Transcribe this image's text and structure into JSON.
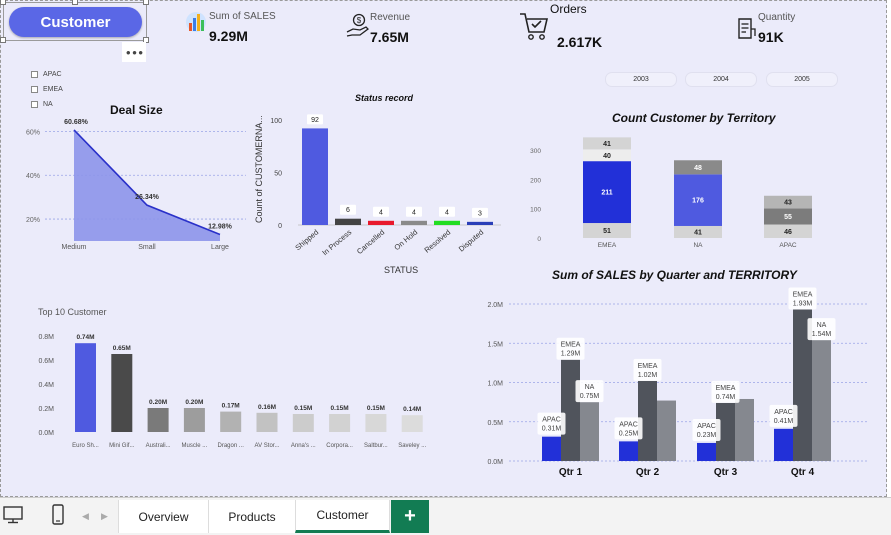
{
  "page_button": {
    "label": "Customer"
  },
  "kpis": [
    {
      "label": "Sum of SALES",
      "value": "9.29M",
      "icon": "bar-chart-icon"
    },
    {
      "label": "Revenue",
      "value": "7.65M",
      "icon": "hand-dollar-icon"
    },
    {
      "label": "Orders",
      "value": "2.617K",
      "icon": "shopping-cart-icon"
    },
    {
      "label": "Quantity",
      "value": "91K",
      "icon": "receipt-icon"
    }
  ],
  "territory_slicer": {
    "items": [
      "APAC",
      "EMEA",
      "NA"
    ]
  },
  "year_slicer": {
    "items": [
      "2003",
      "2004",
      "2005"
    ]
  },
  "colors": {
    "accent": "#5a67e6",
    "tab_green": "#127c53",
    "canvas": "#ebebfa"
  },
  "charts": [
    {
      "type": "area",
      "title": "Deal Size",
      "categories": [
        "Medium",
        "Small",
        "Large"
      ],
      "values": [
        60.68,
        26.34,
        12.98
      ],
      "data_labels": [
        "60.68%",
        "26.34%",
        "12.98%"
      ],
      "y_ticks": [
        "60%",
        "40%",
        "20%"
      ],
      "ylim": [
        10,
        62
      ]
    },
    {
      "type": "bar",
      "title": "Status record",
      "xlabel": "STATUS",
      "ylabel": "Count of CUSTOMERNA...",
      "categories": [
        "Shipped",
        "In Process",
        "Cancelled",
        "On Hold",
        "Resolved",
        "Disputed"
      ],
      "values": [
        92,
        6,
        4,
        4,
        4,
        3
      ],
      "bar_colors": [
        "#4f5ae0",
        "#444444",
        "#e8192c",
        "#8a8a8a",
        "#22dd22",
        "#2a3fb8"
      ],
      "y_ticks": [
        "100",
        "50",
        "0"
      ],
      "ylim": [
        0,
        100
      ]
    },
    {
      "type": "bar",
      "title": "Count Customer by Territory",
      "categories": [
        "EMEA",
        "NA",
        "APAC"
      ],
      "series": [
        {
          "values": [
            51,
            41,
            46
          ],
          "colors": [
            "#d4d4d4",
            "#d4d4d4",
            "#d4d4d4"
          ]
        },
        {
          "values": [
            211,
            176,
            55
          ],
          "colors": [
            "#2230d8",
            "#4f5ae0",
            "#7c7c7c"
          ]
        },
        {
          "values": [
            40,
            48,
            43
          ],
          "colors": [
            "#ededed",
            "#8a8a8a",
            "#b5b5b5"
          ]
        },
        {
          "values": [
            41,
            0,
            0
          ],
          "colors": [
            "#d4d4d4",
            "#d4d4d4",
            "#d4d4d4"
          ]
        }
      ],
      "y_ticks": [
        "300",
        "200",
        "100",
        "0"
      ],
      "ylim": [
        0,
        300
      ]
    },
    {
      "type": "bar",
      "title": "Top 10 Customer",
      "categories": [
        "Euro Sh...",
        "Mini Gif...",
        "Australi...",
        "Muscle ...",
        "Dragon ...",
        "AV Stor...",
        "Anna's ...",
        "Corpora...",
        "Saltbur...",
        "Saveley ..."
      ],
      "values": [
        0.74,
        0.65,
        0.2,
        0.2,
        0.17,
        0.16,
        0.15,
        0.15,
        0.15,
        0.14
      ],
      "data_labels": [
        "0.74M",
        "0.65M",
        "0.20M",
        "0.20M",
        "0.17M",
        "0.16M",
        "0.15M",
        "0.15M",
        "0.15M",
        "0.14M"
      ],
      "bar_colors": [
        "#4f5ae0",
        "#4a4a4a",
        "#7a7a7a",
        "#9d9d9d",
        "#b2b2b2",
        "#c2c2c2",
        "#cccccc",
        "#d2d2d2",
        "#d8d8d8",
        "#dcdcdc"
      ],
      "y_ticks": [
        "0.8M",
        "0.6M",
        "0.4M",
        "0.2M",
        "0.0M"
      ],
      "ylim": [
        0,
        0.8
      ]
    },
    {
      "type": "bar",
      "title": "Sum of SALES by Quarter and TERRITORY",
      "categories": [
        "Qtr 1",
        "Qtr 2",
        "Qtr 3",
        "Qtr 4"
      ],
      "series": [
        {
          "name": "APAC",
          "values": [
            0.31,
            0.25,
            0.23,
            0.41
          ],
          "labels": [
            "0.31M",
            "0.25M",
            "0.23M",
            "0.41M"
          ],
          "color": "#2230d8"
        },
        {
          "name": "EMEA",
          "values": [
            1.29,
            1.02,
            0.74,
            1.93
          ],
          "labels": [
            "1.29M",
            "1.02M",
            "0.74M",
            "1.93M"
          ],
          "color": "#50545c"
        },
        {
          "name": "NA",
          "values": [
            0.75,
            0.77,
            0.79,
            1.54
          ],
          "labels": [
            "0.75M",
            "",
            "",
            "1.54M"
          ],
          "color": "#85888f"
        }
      ],
      "y_ticks": [
        "2.0M",
        "1.5M",
        "1.0M",
        "0.5M",
        "0.0M"
      ],
      "ylim": [
        0,
        2.0
      ]
    }
  ],
  "tabs": {
    "items": [
      "Overview",
      "Products",
      "Customer"
    ],
    "active": "Customer"
  }
}
